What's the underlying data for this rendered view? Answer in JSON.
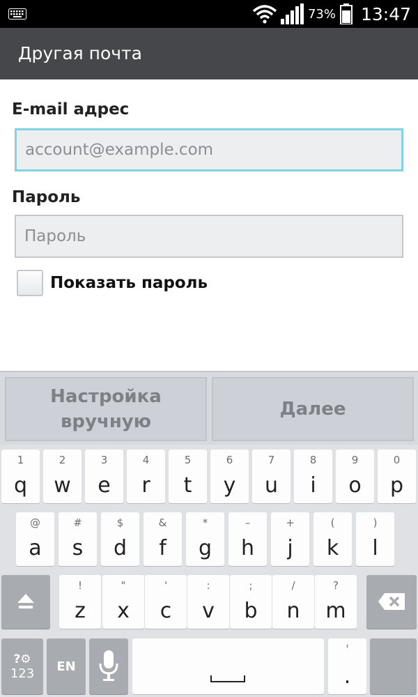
{
  "status_bar": {
    "battery_percent": "73%",
    "time": "13:47",
    "icons": [
      "keyboard-icon",
      "wifi-icon",
      "signal-icon",
      "battery-icon"
    ]
  },
  "title_bar": {
    "title": "Другая почта"
  },
  "form": {
    "email_label": "E-mail адрес",
    "email_placeholder": "account@example.com",
    "email_value": "",
    "password_label": "Пароль",
    "password_placeholder": "Пароль",
    "password_value": "",
    "show_password_label": "Показать пароль",
    "show_password_checked": false
  },
  "actions": {
    "manual_setup_line1": "Настройка",
    "manual_setup_line2": "вручную",
    "next_label": "Далее"
  },
  "keyboard": {
    "row1": [
      {
        "hint": "1",
        "key": "q"
      },
      {
        "hint": "2",
        "key": "w"
      },
      {
        "hint": "3",
        "key": "e"
      },
      {
        "hint": "4",
        "key": "r"
      },
      {
        "hint": "5",
        "key": "t"
      },
      {
        "hint": "6",
        "key": "y"
      },
      {
        "hint": "7",
        "key": "u"
      },
      {
        "hint": "8",
        "key": "i"
      },
      {
        "hint": "9",
        "key": "o"
      },
      {
        "hint": "0",
        "key": "p"
      }
    ],
    "row2": [
      {
        "hint": "@",
        "key": "a"
      },
      {
        "hint": "#",
        "key": "s"
      },
      {
        "hint": "$",
        "key": "d"
      },
      {
        "hint": "&",
        "key": "f"
      },
      {
        "hint": "*",
        "key": "g"
      },
      {
        "hint": "–",
        "key": "h"
      },
      {
        "hint": "+",
        "key": "j"
      },
      {
        "hint": "(",
        "key": "k"
      },
      {
        "hint": ")",
        "key": "l"
      }
    ],
    "row3": [
      {
        "hint": "!",
        "key": "z"
      },
      {
        "hint": "\"",
        "key": "x"
      },
      {
        "hint": "'",
        "key": "c"
      },
      {
        "hint": ":",
        "key": "v"
      },
      {
        "hint": ";",
        "key": "b"
      },
      {
        "hint": "/",
        "key": "n"
      },
      {
        "hint": "?",
        "key": "m"
      }
    ],
    "symbols_key_top": "?⚙",
    "symbols_key_bottom": "123",
    "language_key": "EN",
    "period_hint": "'",
    "period_key": ".",
    "colors": {
      "key_bg": "#fdfdfd",
      "dark_key_bg": "#a8abb0",
      "keyboard_bg": "#dfe1e4"
    }
  },
  "colors": {
    "title_bar_bg": "#46474b",
    "focus_border": "#7fd3e2",
    "field_bg": "#eceef0",
    "action_bar_bg": "#d7dadf"
  }
}
